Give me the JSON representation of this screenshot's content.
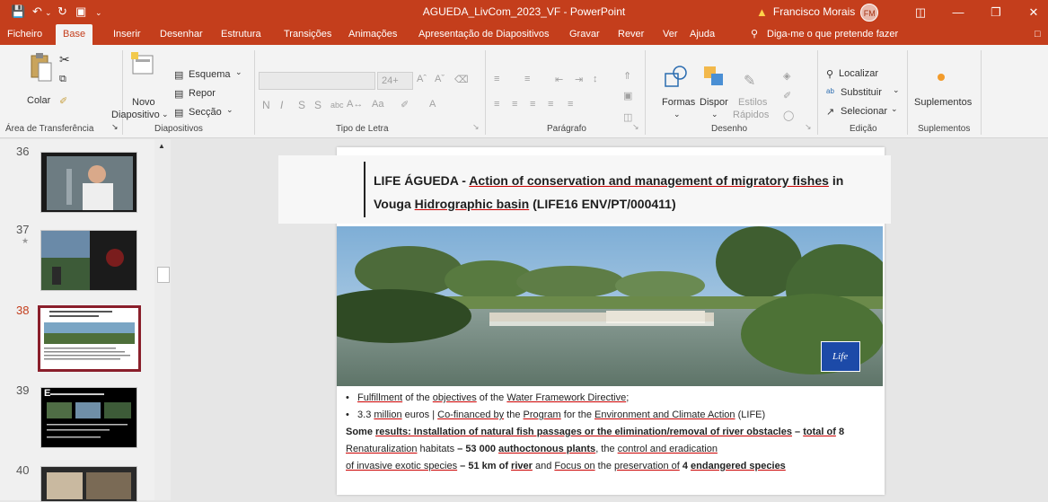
{
  "window": {
    "title": "AGUEDA_LivCom_2023_VF  -  PowerPoint",
    "user_name": "Francisco Morais",
    "user_initials": "FM",
    "accent": "#c43e1c"
  },
  "tabs": [
    "Ficheiro",
    "Base",
    "Inserir",
    "Desenhar",
    "Estrutura",
    "Transições",
    "Animações",
    "Apresentação de Diapositivos",
    "Gravar",
    "Rever",
    "Ver",
    "Ajuda"
  ],
  "tell_me": "Diga-me o que pretende fazer",
  "ribbon": {
    "clipboard": {
      "paste": "Colar",
      "label": "Área de Transferência"
    },
    "slides": {
      "new_slide_1": "Novo",
      "new_slide_2": "Diapositivo",
      "layout": "Esquema",
      "reset": "Repor",
      "section": "Secção",
      "label": "Diapositivos"
    },
    "font": {
      "size": "24+",
      "bold": "N",
      "italic": "I",
      "underline": "S",
      "strike": "S",
      "label": "Tipo de Letra"
    },
    "paragraph": {
      "label": "Parágrafo"
    },
    "drawing": {
      "shapes": "Formas",
      "arrange": "Dispor",
      "styles_1": "Estilos",
      "styles_2": "Rápidos",
      "label": "Desenho"
    },
    "editing": {
      "find": "Localizar",
      "replace": "Substituir",
      "select": "Selecionar",
      "label": "Edição"
    },
    "addins": {
      "addins": "Suplementos",
      "label": "Suplementos"
    }
  },
  "thumbnails": {
    "numbers": [
      "36",
      "37",
      "38",
      "39",
      "40"
    ],
    "star": "★",
    "thumb39_letter": "E"
  },
  "slide": {
    "title_prefix": "LIFE ÁGUEDA - ",
    "title_u1": "Action of conservation and management of ",
    "title_u2": "migratory fishes",
    "title_mid": " in Vouga ",
    "title_u3": "Hidrographic basin",
    "title_end": " (LIFE16 ENV/PT/000411)",
    "logo_text": "Life",
    "bullet_char": "•",
    "b1_a": "Fulfillment",
    "b1_b": " of the ",
    "b1_c": "objectives",
    "b1_d": " of the ",
    "b1_e": "Water Framework Directive",
    "b1_f": ";",
    "b2_a": "3.3 ",
    "b2_b": "million",
    "b2_c": " euros  |  ",
    "b2_d": "Co-financed by",
    "b2_e": " the ",
    "b2_f": "Program",
    "b2_g": " for the ",
    "b2_h": "Environment and Climate Action",
    "b2_i": " (LIFE)",
    "l3_a": "Some ",
    "l3_b": "results: Installation of natural fish passages or the elimination/removal of river obstacles",
    "l3_c": " – ",
    "l3_d": "total of",
    "l3_e": " 8",
    "l4_a": "Renaturalization",
    "l4_b": " habitats ",
    "l4_c": "– 53 000 ",
    "l4_d": "authoctonous plants",
    "l4_e": ", the ",
    "l4_f": "control and eradication",
    "l5_a": "of invasive exotic species",
    "l5_b": " – 51 km of ",
    "l5_c": "river",
    "l5_d": " and ",
    "l5_e": "Focus on",
    "l5_f": " the ",
    "l5_g": "preservation of",
    "l5_h": " 4 ",
    "l5_i": "endangered species"
  }
}
